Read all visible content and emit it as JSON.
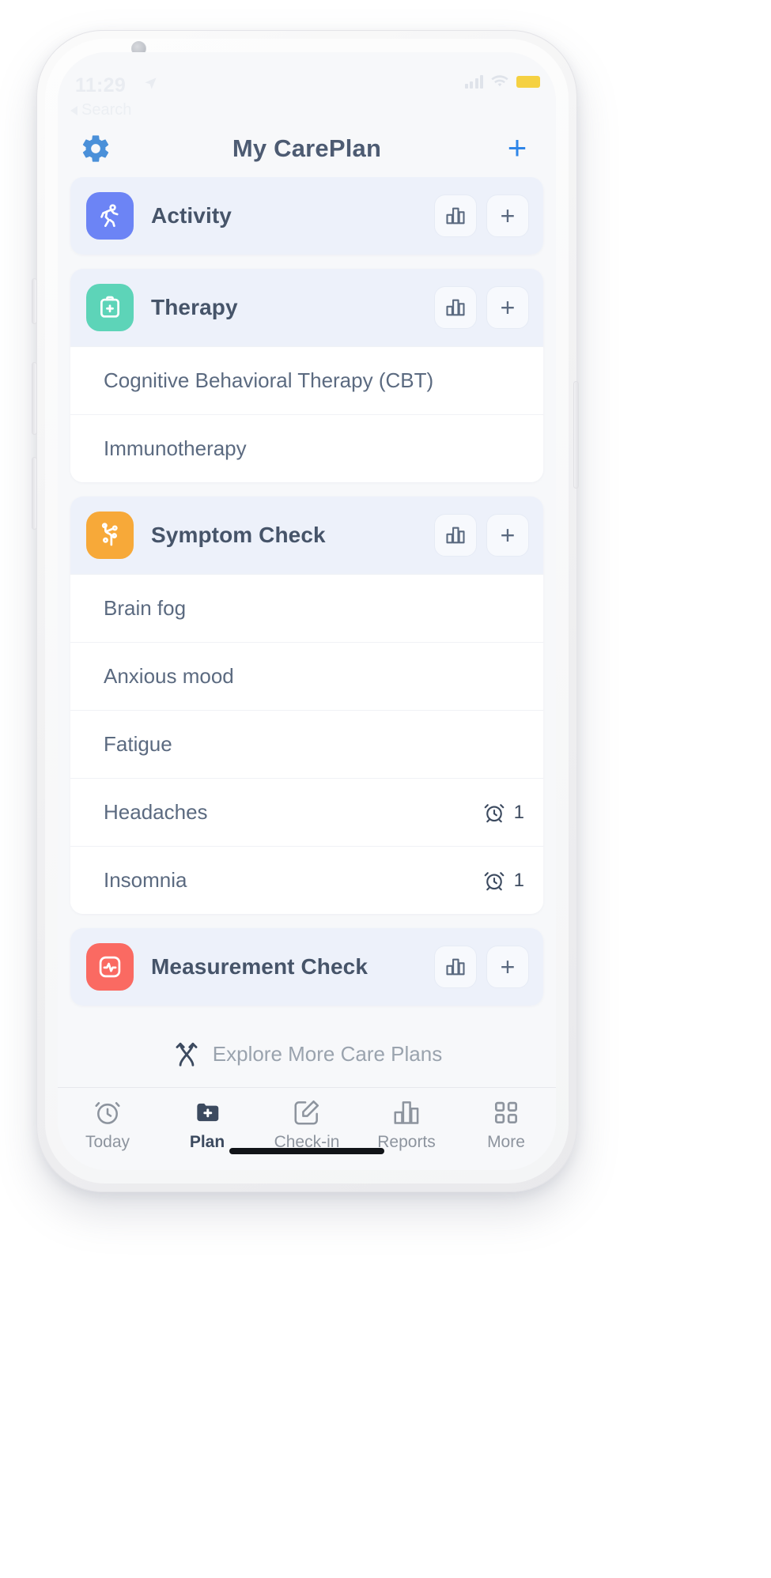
{
  "status_bar": {
    "time": "11:29",
    "location_icon": "location-arrow-icon",
    "back_label": "Search",
    "signal_icon": "cellular-signal-icon",
    "wifi_icon": "wifi-icon",
    "battery_icon": "battery-icon",
    "battery_color": "#f5d142"
  },
  "header": {
    "settings_icon": "gear-icon",
    "title": "My CarePlan",
    "add_label": "+",
    "accent_color": "#2f86e8"
  },
  "sections": [
    {
      "title": "Activity",
      "icon": "running-person-icon",
      "icon_color": "#6c84f5",
      "chart_button": "bar-chart-icon",
      "add_button": "+",
      "items": []
    },
    {
      "title": "Therapy",
      "icon": "clipboard-plus-icon",
      "icon_color": "#5dd4b8",
      "chart_button": "bar-chart-icon",
      "add_button": "+",
      "items": [
        {
          "label": "Cognitive Behavioral Therapy (CBT)",
          "reminder_count": ""
        },
        {
          "label": "Immunotherapy",
          "reminder_count": ""
        }
      ]
    },
    {
      "title": "Symptom Check",
      "icon": "symptom-molecule-icon",
      "icon_color": "#f7a939",
      "chart_button": "bar-chart-icon",
      "add_button": "+",
      "items": [
        {
          "label": "Brain fog",
          "reminder_count": ""
        },
        {
          "label": "Anxious mood",
          "reminder_count": ""
        },
        {
          "label": "Fatigue",
          "reminder_count": ""
        },
        {
          "label": "Headaches",
          "reminder_count": "1"
        },
        {
          "label": "Insomnia",
          "reminder_count": "1"
        }
      ]
    },
    {
      "title": "Measurement Check",
      "icon": "measurement-monitor-icon",
      "icon_color": "#fa6a62",
      "chart_button": "bar-chart-icon",
      "add_button": "+",
      "items": []
    }
  ],
  "explore": {
    "icon": "crossed-arrows-icon",
    "label": "Explore More Care Plans"
  },
  "tabbar": {
    "active": "Plan",
    "tabs": [
      {
        "label": "Today",
        "icon": "alarm-clock-icon"
      },
      {
        "label": "Plan",
        "icon": "folder-plus-icon"
      },
      {
        "label": "Check-in",
        "icon": "pencil-square-icon"
      },
      {
        "label": "Reports",
        "icon": "bar-chart-icon"
      },
      {
        "label": "More",
        "icon": "grid-dots-icon"
      }
    ]
  }
}
